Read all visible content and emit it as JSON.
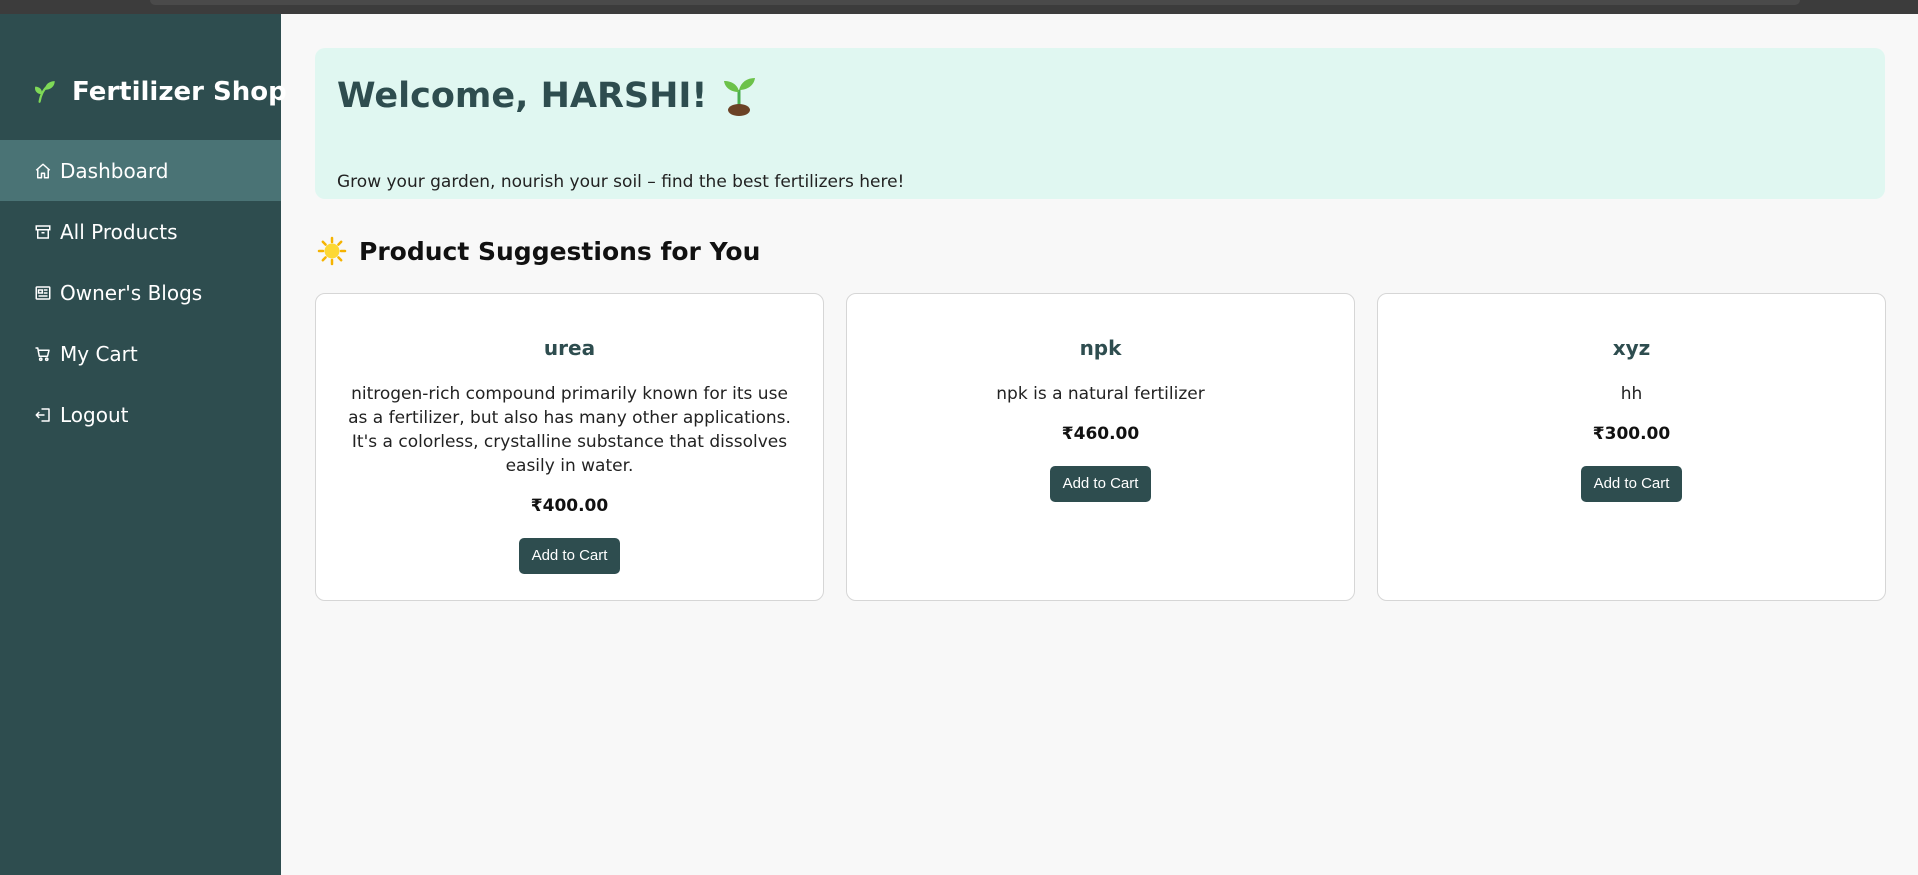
{
  "app": {
    "title": "Fertilizer Shop",
    "brand_icon": "leaf-icon",
    "colors": {
      "sidebar": "#2e4d4f",
      "sidebar_active": "#4a7375",
      "welcome_bg": "#e0f7f1",
      "accent": "#2e4d4f",
      "page_bg": "#f8f8f8"
    }
  },
  "sidebar": {
    "items": [
      {
        "label": "Dashboard",
        "icon": "home-icon",
        "active": true
      },
      {
        "label": "All Products",
        "icon": "archive-box-icon",
        "active": false
      },
      {
        "label": "Owner's Blogs",
        "icon": "newspaper-icon",
        "active": false
      },
      {
        "label": "My Cart",
        "icon": "cart-icon",
        "active": false
      },
      {
        "label": "Logout",
        "icon": "logout-icon",
        "active": false
      }
    ]
  },
  "welcome": {
    "title": "Welcome, HARSHI!",
    "icon": "seedling-icon",
    "subtitle": "Grow your garden, nourish your soil – find the best fertilizers here!"
  },
  "suggestions": {
    "title": "Product Suggestions for You",
    "icon": "sun-icon",
    "products": [
      {
        "name": "urea",
        "description": "nitrogen-rich compound primarily known for its use as a fertilizer, but also has many other applications. It's a colorless, crystalline substance that dissolves easily in water.",
        "price": "₹400.00",
        "button": "Add to Cart"
      },
      {
        "name": "npk",
        "description": "npk is a natural fertilizer",
        "price": "₹460.00",
        "button": "Add to Cart"
      },
      {
        "name": "xyz",
        "description": "hh",
        "price": "₹300.00",
        "button": "Add to Cart"
      }
    ]
  }
}
